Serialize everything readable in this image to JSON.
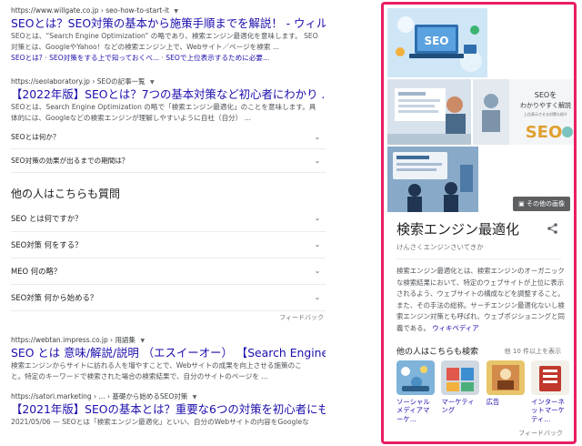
{
  "results": [
    {
      "url": "https://www.willgate.co.jp",
      "path": "› seo-how-to-start-it",
      "title": "SEOとは？SEO対策の基本から施策手順までを解説！ - ウィル ...",
      "snippet_lines": [
        "SEOとは、“Search Engine Optimization” の略であり、検索エンジン最適化を意味します。 SEO",
        "対策とは、GoogleやYahoo！などの検索エンジン上で、Webサイト／ページを検索 ..."
      ],
      "sublinks": [
        "SEOとは?",
        "SEO対策をする上で知っておくべ...",
        "SEOで上位表示するために必要..."
      ]
    },
    {
      "url": "https://seolaboratory.jp",
      "path": "› SEOの記事一覧",
      "title": "【2022年版】SEOとは？7つの基本対策など初心者にわかり ...",
      "snippet_lines": [
        "SEOとは、Search Engine Optimization の略で「検索エンジン最適化」のことを意味します。具",
        "体的には、Googleなどの検索エンジンが理解しやすいように自社（自分） ..."
      ],
      "sitelinks": [
        "SEOとは何か？",
        "SEO対策の効果が出るまでの期間は？"
      ]
    },
    {
      "url": "https://webtan.impress.co.jp",
      "path": "› 用語集",
      "title": "SEO とは 意味/解説/説明 （エスイーオー） 【Search Engine ...",
      "snippet_lines": [
        "検索エンジンからサイトに訪れる人を増やすことで、Webサイトの成果を向上させる施策のこ",
        "と。特定のキーワードで検索された場合の検索結果で、自分のサイトのページを ..."
      ]
    },
    {
      "url": "https://satori.marketing",
      "path": "› ... › 基礎から始めるSEO対策",
      "title": "【2021年版】SEOの基本とは？重要な6つの対策を初心者にも ...",
      "snippet_lines": [
        "2021/05/06 — SEOとは「検索エンジン最適化」といい、自分のWebサイトの内容をGoogleな"
      ]
    }
  ],
  "people_also_ask": {
    "heading": "他の人はこちらも質問",
    "questions": [
      "SEO とは何ですか？",
      "SEO対策 何をする？",
      "MEO 何の略？",
      "SEO対策 何から始める？"
    ],
    "feedback": "フィードバック"
  },
  "knowledge_panel": {
    "more_images": "その他の画像",
    "image_texts": {
      "seo_logo": "SEO",
      "img3_line1": "SEOを",
      "img3_line2": "わかりやすく解説",
      "img3_line3": "上位表示させる対策も紹介",
      "img3_big": "SEO"
    },
    "title": "検索エンジン最適化",
    "reading": "けんさくエンジンさいてきか",
    "description": "検索エンジン最適化とは、検索エンジンのオーガニックな検索結果において、特定のウェブサイトが上位に表示されるよう、ウェブサイトの構成などを調整すること。また、その手法の総称。サーチエンジン最適化ないし検索エンジン対策とも呼ばれ、ウェブポジショニングと同義である。",
    "wiki_link": "ウィキペディア",
    "people_also_search": {
      "heading": "他の人はこちらも検索",
      "more": "他 10 件以上を表示",
      "items": [
        {
          "label": "ソーシャルメディアマーケ..."
        },
        {
          "label": "マーケティング"
        },
        {
          "label": "広告"
        },
        {
          "label": "インターネットマーケティ..."
        }
      ]
    },
    "feedback": "フィードバック"
  },
  "colors": {
    "link": "#1a0dab",
    "panel_border": "#e91e63"
  }
}
